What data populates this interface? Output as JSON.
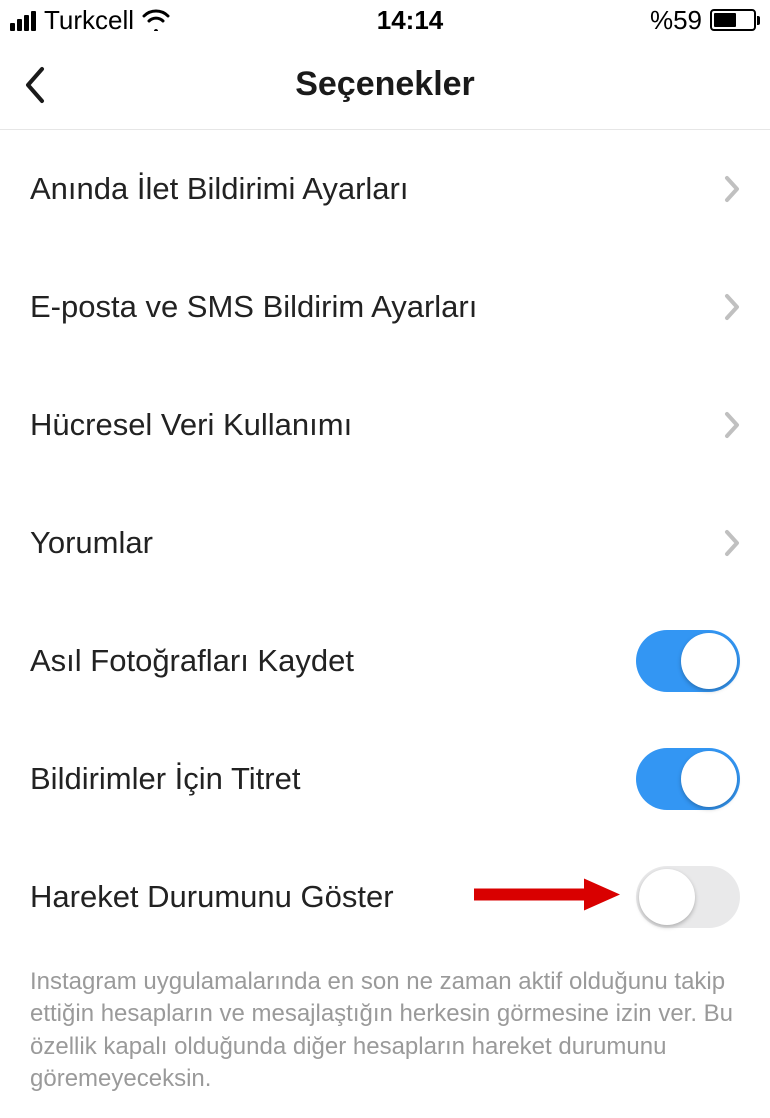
{
  "status": {
    "carrier": "Turkcell",
    "time": "14:14",
    "battery_pct": "%59"
  },
  "header": {
    "title": "Seçenekler"
  },
  "rows": {
    "push": {
      "label": "Anında İlet Bildirimi Ayarları"
    },
    "emailsms": {
      "label": "E-posta ve SMS Bildirim Ayarları"
    },
    "cellular": {
      "label": "Hücresel Veri Kullanımı"
    },
    "comments": {
      "label": "Yorumlar"
    },
    "savephotos": {
      "label": "Asıl Fotoğrafları Kaydet",
      "on": true
    },
    "vibrate": {
      "label": "Bildirimler İçin Titret",
      "on": true
    },
    "activity": {
      "label": "Hareket Durumunu Göster",
      "on": false
    }
  },
  "footer": "Instagram uygulamalarında en son ne zaman aktif olduğunu takip ettiğin hesapların ve mesajlaştığın herkesin görmesine izin ver. Bu özellik kapalı olduğunda diğer hesapların hareket durumunu göremeyeceksin."
}
